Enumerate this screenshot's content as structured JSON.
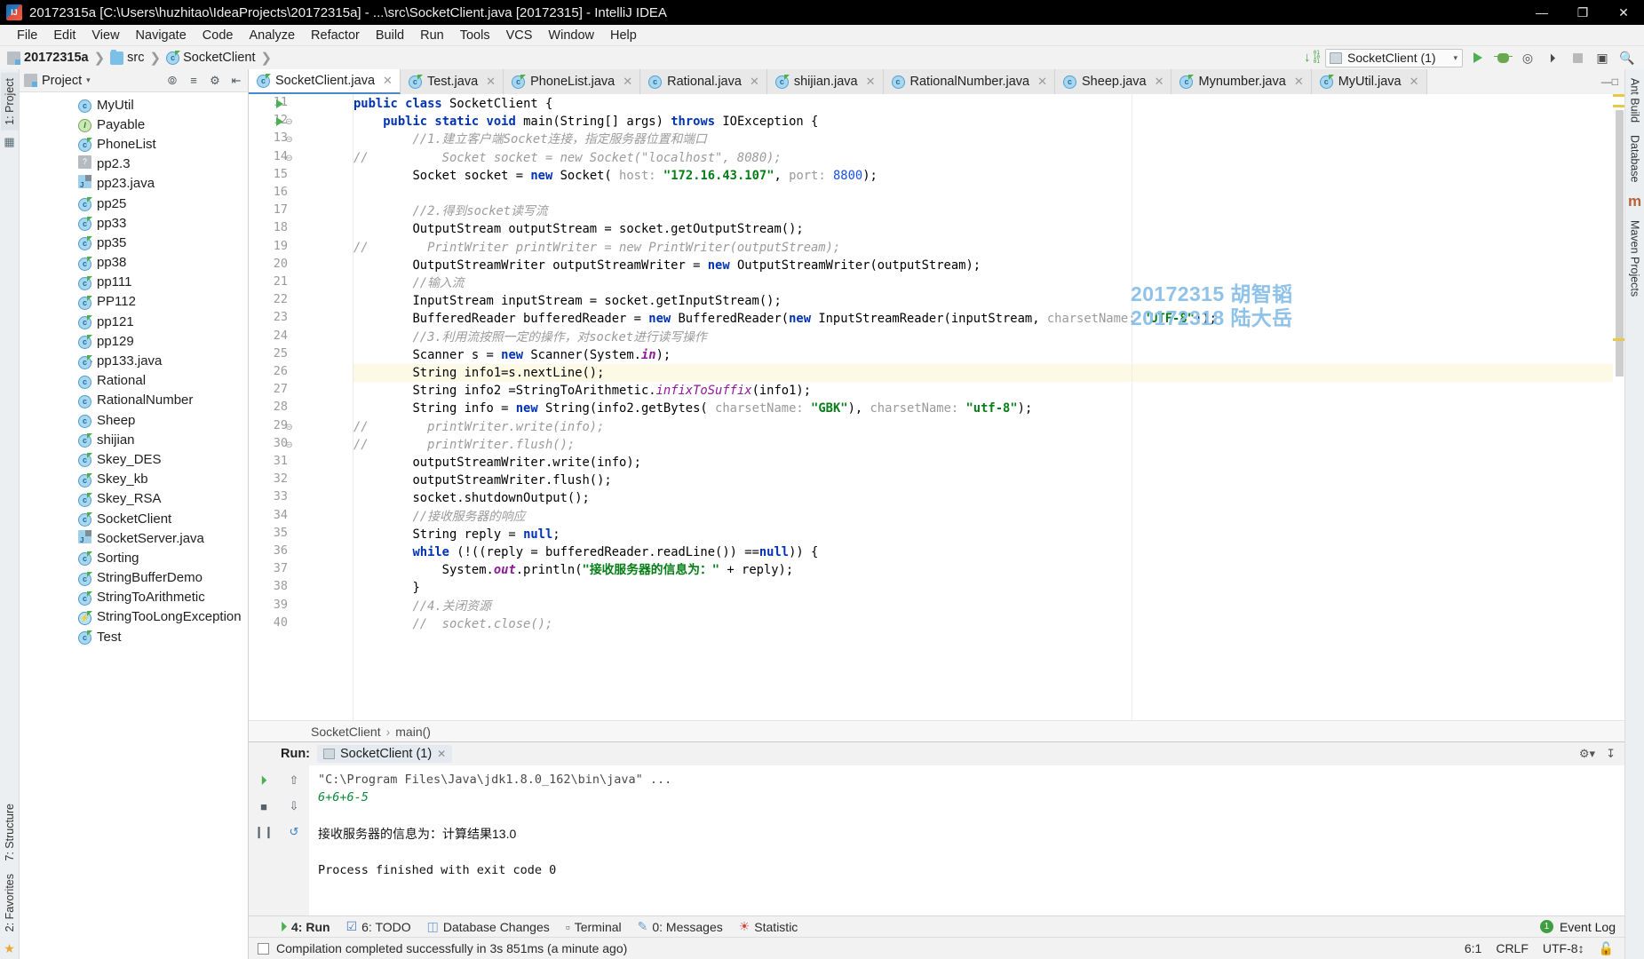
{
  "window": {
    "title": "20172315a [C:\\Users\\huzhitao\\IdeaProjects\\20172315a] - ...\\src\\SocketClient.java [20172315] - IntelliJ IDEA",
    "app_icon": "intellij-idea-icon",
    "minimize": "—",
    "maximize": "❐",
    "close": "✕"
  },
  "menu": [
    {
      "label": "File"
    },
    {
      "label": "Edit"
    },
    {
      "label": "View"
    },
    {
      "label": "Navigate"
    },
    {
      "label": "Code"
    },
    {
      "label": "Analyze"
    },
    {
      "label": "Refactor"
    },
    {
      "label": "Build"
    },
    {
      "label": "Run"
    },
    {
      "label": "Tools"
    },
    {
      "label": "VCS"
    },
    {
      "label": "Window"
    },
    {
      "label": "Help"
    }
  ],
  "navbar": {
    "crumbs": [
      {
        "label": "20172315a",
        "icon": "module-icon"
      },
      {
        "label": "src",
        "icon": "folder-icon"
      },
      {
        "label": "SocketClient",
        "icon": "java-class-icon"
      }
    ],
    "separator": "❯",
    "run_config": "SocketClient (1)",
    "run_config_chevron": "▾",
    "toolbar_icons": [
      "compile-icon",
      "run-icon",
      "debug-icon",
      "run-coverage-icon",
      "attach-profiler-icon",
      "stop-icon",
      "layout-icon",
      "search-icon"
    ]
  },
  "left_strip": {
    "tabs": [
      {
        "label": "1: Project",
        "active": true
      },
      {
        "label": "7: Structure",
        "active": false
      },
      {
        "label": "2: Favorites",
        "active": false
      }
    ],
    "icons": [
      "database-pin-icon",
      "star-icon"
    ]
  },
  "right_strip": {
    "tabs": [
      {
        "label": "Ant Build"
      },
      {
        "label": "Database"
      },
      {
        "label": "Maven Projects"
      }
    ],
    "icons": [
      "maven-m-icon"
    ]
  },
  "project_panel": {
    "title": "Project",
    "title_chevron": "▾",
    "header_icons": [
      "locate-icon",
      "collapse-all-icon",
      "settings-icon",
      "hide-icon"
    ],
    "tree": [
      {
        "label": "MyUtil",
        "icon": "java-class-icon",
        "expandable": false
      },
      {
        "label": "Payable",
        "icon": "java-interface-icon",
        "expandable": false
      },
      {
        "label": "PhoneList",
        "icon": "java-class-public-icon",
        "expandable": false
      },
      {
        "label": "pp2.3",
        "icon": "unknown-file-icon",
        "expandable": false
      },
      {
        "label": "pp23.java",
        "icon": "java-file-icon",
        "expandable": false
      },
      {
        "label": "pp25",
        "icon": "java-class-public-icon",
        "expandable": false
      },
      {
        "label": "pp33",
        "icon": "java-class-public-icon",
        "expandable": false
      },
      {
        "label": "pp35",
        "icon": "java-class-public-icon",
        "expandable": false
      },
      {
        "label": "pp38",
        "icon": "java-class-public-icon",
        "expandable": false
      },
      {
        "label": "pp111",
        "icon": "java-class-public-icon",
        "expandable": false
      },
      {
        "label": "PP112",
        "icon": "java-class-public-icon",
        "expandable": false
      },
      {
        "label": "pp121",
        "icon": "java-class-public-icon",
        "expandable": false
      },
      {
        "label": "pp129",
        "icon": "java-class-public-icon",
        "expandable": false
      },
      {
        "label": "pp133.java",
        "icon": "java-class-public-icon",
        "expandable": true
      },
      {
        "label": "Rational",
        "icon": "java-class-icon",
        "expandable": false
      },
      {
        "label": "RationalNumber",
        "icon": "java-class-icon",
        "expandable": false
      },
      {
        "label": "Sheep",
        "icon": "java-class-icon",
        "expandable": false
      },
      {
        "label": "shijian",
        "icon": "java-class-public-icon",
        "expandable": false
      },
      {
        "label": "Skey_DES",
        "icon": "java-class-public-icon",
        "expandable": false
      },
      {
        "label": "Skey_kb",
        "icon": "java-class-public-icon",
        "expandable": false
      },
      {
        "label": "Skey_RSA",
        "icon": "java-class-public-icon",
        "expandable": false
      },
      {
        "label": "SocketClient",
        "icon": "java-class-public-icon",
        "expandable": false
      },
      {
        "label": "SocketServer.java",
        "icon": "java-file-icon",
        "expandable": false
      },
      {
        "label": "Sorting",
        "icon": "java-class-public-icon",
        "expandable": false
      },
      {
        "label": "StringBufferDemo",
        "icon": "java-class-public-icon",
        "expandable": false
      },
      {
        "label": "StringToArithmetic",
        "icon": "java-class-public-icon",
        "expandable": false
      },
      {
        "label": "StringTooLongException",
        "icon": "java-class-exception-icon",
        "expandable": false
      },
      {
        "label": "Test",
        "icon": "java-class-public-icon",
        "expandable": false
      }
    ],
    "expand_arrow": "›"
  },
  "editor_tabs": [
    {
      "label": "SocketClient.java",
      "active": true,
      "icon": "java-class-public-icon",
      "close": "✕"
    },
    {
      "label": "Test.java",
      "active": false,
      "icon": "java-class-public-icon",
      "close": "✕"
    },
    {
      "label": "PhoneList.java",
      "active": false,
      "icon": "java-class-public-icon",
      "close": "✕"
    },
    {
      "label": "Rational.java",
      "active": false,
      "icon": "java-class-icon",
      "close": "✕"
    },
    {
      "label": "shijian.java",
      "active": false,
      "icon": "java-class-public-icon",
      "close": "✕"
    },
    {
      "label": "RationalNumber.java",
      "active": false,
      "icon": "java-class-icon",
      "close": "✕"
    },
    {
      "label": "Sheep.java",
      "active": false,
      "icon": "java-class-icon",
      "close": "✕"
    },
    {
      "label": "Mynumber.java",
      "active": false,
      "icon": "java-class-public-icon",
      "close": "✕"
    },
    {
      "label": "MyUtil.java",
      "active": false,
      "icon": "java-class-public-icon",
      "close": "✕"
    }
  ],
  "editor": {
    "first_line_number": 11,
    "caret_line": 26,
    "line_numbers": [
      11,
      12,
      13,
      14,
      15,
      16,
      17,
      18,
      19,
      20,
      21,
      22,
      23,
      24,
      25,
      26,
      27,
      28,
      29,
      30,
      31,
      32,
      33,
      34,
      35,
      36,
      37,
      38,
      39,
      40
    ],
    "run_markers": [
      11,
      12
    ],
    "watermark": [
      "20172315 胡智韬",
      "20172318 陆大岳"
    ],
    "watermark_color": "#8fc2e8",
    "lines": [
      {
        "n": 11,
        "text": "public class SocketClient {"
      },
      {
        "n": 12,
        "text": "    public static void main(String[] args) throws IOException {"
      },
      {
        "n": 13,
        "text": "        //1.建立客户端Socket连接，指定服务器位置和端口"
      },
      {
        "n": 14,
        "text": "//          Socket socket = new Socket(\"localhost\", 8080);"
      },
      {
        "n": 15,
        "text": "        Socket socket = new Socket( host: \"172.16.43.107\", port: 8800);"
      },
      {
        "n": 16,
        "text": ""
      },
      {
        "n": 17,
        "text": "        //2.得到socket读写流"
      },
      {
        "n": 18,
        "text": "        OutputStream outputStream = socket.getOutputStream();"
      },
      {
        "n": 19,
        "text": "//        PrintWriter printWriter = new PrintWriter(outputStream);"
      },
      {
        "n": 20,
        "text": "        OutputStreamWriter outputStreamWriter = new OutputStreamWriter(outputStream);"
      },
      {
        "n": 21,
        "text": "        //输入流"
      },
      {
        "n": 22,
        "text": "        InputStream inputStream = socket.getInputStream();"
      },
      {
        "n": 23,
        "text": "        BufferedReader bufferedReader = new BufferedReader(new InputStreamReader(inputStream, charsetName: \"UTF-8\"));"
      },
      {
        "n": 24,
        "text": "        //3.利用流按照一定的操作，对socket进行读写操作"
      },
      {
        "n": 25,
        "text": "        Scanner s = new Scanner(System.in);"
      },
      {
        "n": 26,
        "text": "        String info1=s.nextLine();"
      },
      {
        "n": 27,
        "text": "        String info2 =StringToArithmetic.infixToSuffix(info1);"
      },
      {
        "n": 28,
        "text": "        String info = new String(info2.getBytes( charsetName: \"GBK\"), charsetName: \"utf-8\");"
      },
      {
        "n": 29,
        "text": "//        printWriter.write(info);"
      },
      {
        "n": 30,
        "text": "//        printWriter.flush();"
      },
      {
        "n": 31,
        "text": "        outputStreamWriter.write(info);"
      },
      {
        "n": 32,
        "text": "        outputStreamWriter.flush();"
      },
      {
        "n": 33,
        "text": "        socket.shutdownOutput();"
      },
      {
        "n": 34,
        "text": "        //接收服务器的响应"
      },
      {
        "n": 35,
        "text": "        String reply = null;"
      },
      {
        "n": 36,
        "text": "        while (!((reply = bufferedReader.readLine()) ==null)) {"
      },
      {
        "n": 37,
        "text": "            System.out.println(\"接收服务器的信息为：\" + reply);"
      },
      {
        "n": 38,
        "text": "        }"
      },
      {
        "n": 39,
        "text": "        //4.关闭资源"
      },
      {
        "n": 40,
        "text": "        //  socket.close();"
      }
    ],
    "breadcrumb": [
      "SocketClient",
      "main()"
    ],
    "breadcrumb_sep": "›"
  },
  "run_panel": {
    "label": "Run:",
    "tab": "SocketClient (1)",
    "tab_close": "✕",
    "toolbar_icons": [
      "rerun-icon",
      "stop-icon",
      "pause-icon",
      "up-stack-icon",
      "down-stack-icon",
      "soft-wrap-icon",
      "settings-icon",
      "hide-icon"
    ],
    "console_lines": [
      {
        "text": "\"C:\\Program Files\\Java\\jdk1.8.0_162\\bin\\java\" ...",
        "style": "path"
      },
      {
        "text": "6+6+6-5",
        "style": "inp"
      },
      {
        "text": "",
        "style": "out"
      },
      {
        "text": "接收服务器的信息为：计算结果13.0",
        "style": "out"
      },
      {
        "text": "",
        "style": "out"
      },
      {
        "text": "Process finished with exit code 0",
        "style": "fin"
      }
    ]
  },
  "tool_window_bar": {
    "items": [
      {
        "label": "4: Run",
        "icon": "run-icon",
        "active": true
      },
      {
        "label": "6: TODO",
        "icon": "todo-icon",
        "active": false
      },
      {
        "label": "Database Changes",
        "icon": "database-icon",
        "active": false
      },
      {
        "label": "Terminal",
        "icon": "terminal-icon",
        "active": false
      },
      {
        "label": "0: Messages",
        "icon": "messages-icon",
        "active": false
      },
      {
        "label": "Statistic",
        "icon": "statistic-icon",
        "active": false
      }
    ],
    "event_log": "Event Log",
    "event_badge": "1"
  },
  "status_bar": {
    "message": "Compilation completed successfully in 3s 851ms (a minute ago)",
    "caret_position": "6:1",
    "line_separator": "CRLF",
    "encoding": "UTF-8",
    "encoding_chevron": "↕",
    "lock_icon": "lock-icon"
  },
  "colors": {
    "accent": "#4a89c8",
    "keyword": "#0033b3",
    "string": "#067d17",
    "comment": "#9b9b9b",
    "number": "#1750eb",
    "field": "#8c1a94",
    "green_run": "#4caf50"
  }
}
